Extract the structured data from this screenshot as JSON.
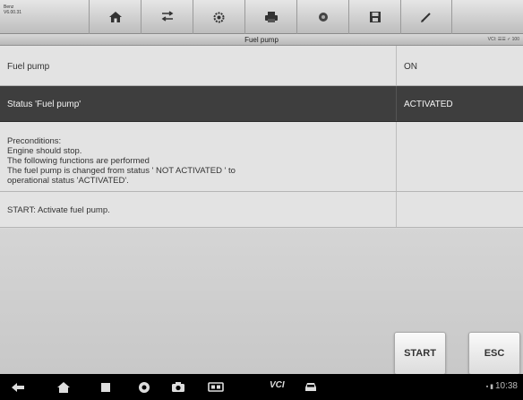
{
  "vehicle": {
    "line1": "Benz",
    "line2": "V6.00.31"
  },
  "toolbar": {
    "icons": [
      "home-icon",
      "vehicle-swap-icon",
      "settings-icon",
      "print-icon",
      "help-icon",
      "save-icon",
      "edit-icon"
    ]
  },
  "title": "Fuel pump",
  "vci_status": "VCI: ☰☰ ✓ 100",
  "rows": [
    {
      "label": "Fuel pump",
      "value": "ON"
    },
    {
      "label": "Status 'Fuel pump'",
      "value": "ACTIVATED"
    },
    {
      "lines": [
        "Preconditions:",
        "Engine should stop.",
        "The following functions are performed",
        "The fuel pump is changed from status ' NOT ACTIVATED ' to",
        "operational status 'ACTIVATED'."
      ],
      "value": ""
    },
    {
      "label": "START: Activate fuel pump.",
      "value": ""
    }
  ],
  "buttons": {
    "start": "START",
    "esc": "ESC"
  },
  "navbar": {
    "vci_label": "VCI",
    "clock": "10:38",
    "icons": [
      "back-icon",
      "home-icon",
      "recent-apps-icon",
      "browser-icon",
      "camera-icon",
      "screen-switch-icon",
      "car-icon"
    ]
  },
  "colors": {
    "highlight_row": "#3e3e3e",
    "background": "#e3e3e3"
  }
}
